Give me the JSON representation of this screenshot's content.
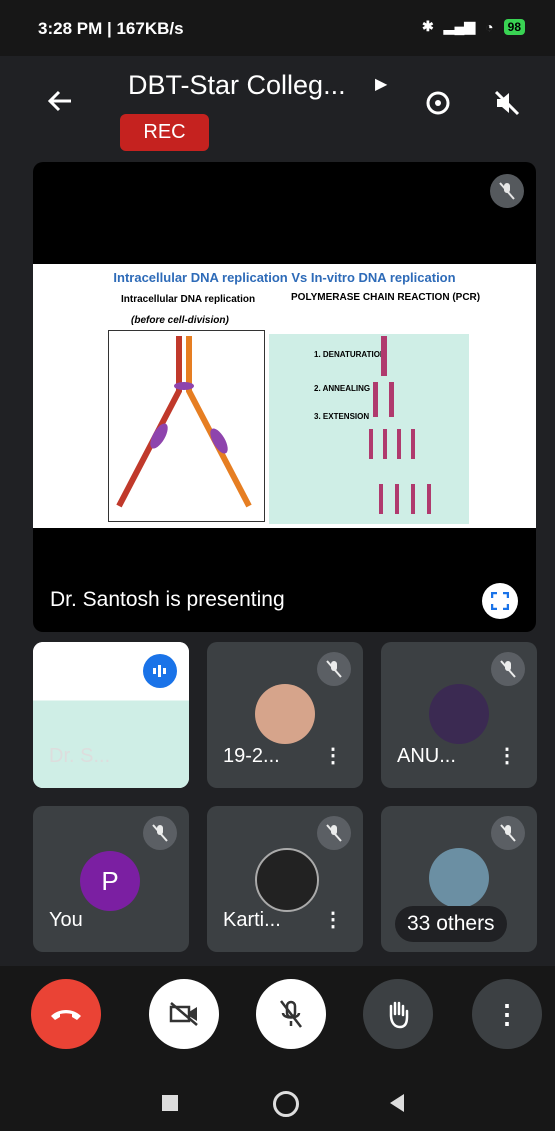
{
  "status_bar": {
    "time_speed": "3:28 PM | 167KB/s",
    "battery": "98"
  },
  "header": {
    "title": "DBT-Star Colleg...",
    "rec_label": "REC"
  },
  "presentation": {
    "slide_title": "Intracellular DNA replication Vs In-vitro DNA replication",
    "left_heading": "Intracellular DNA replication",
    "left_sub": "(before cell-division)",
    "right_heading": "POLYMERASE CHAIN REACTION (PCR)",
    "pcr_steps": [
      "1. DENATURATION",
      "2. ANNEALING",
      "3. EXTENSION"
    ],
    "presenting_label": "Dr. Santosh is presenting"
  },
  "participants": [
    {
      "name": "Dr. S...",
      "type": "screen"
    },
    {
      "name": "19-2...",
      "type": "photo"
    },
    {
      "name": "ANU...",
      "type": "photo"
    },
    {
      "name": "You",
      "type": "initial",
      "initial": "P",
      "color": "#7b1fa2"
    },
    {
      "name": "Karti...",
      "type": "photo"
    },
    {
      "name": "33 others",
      "type": "others"
    }
  ],
  "colors": {
    "end_call": "#ea4335",
    "accent_blue": "#1a73e8"
  }
}
